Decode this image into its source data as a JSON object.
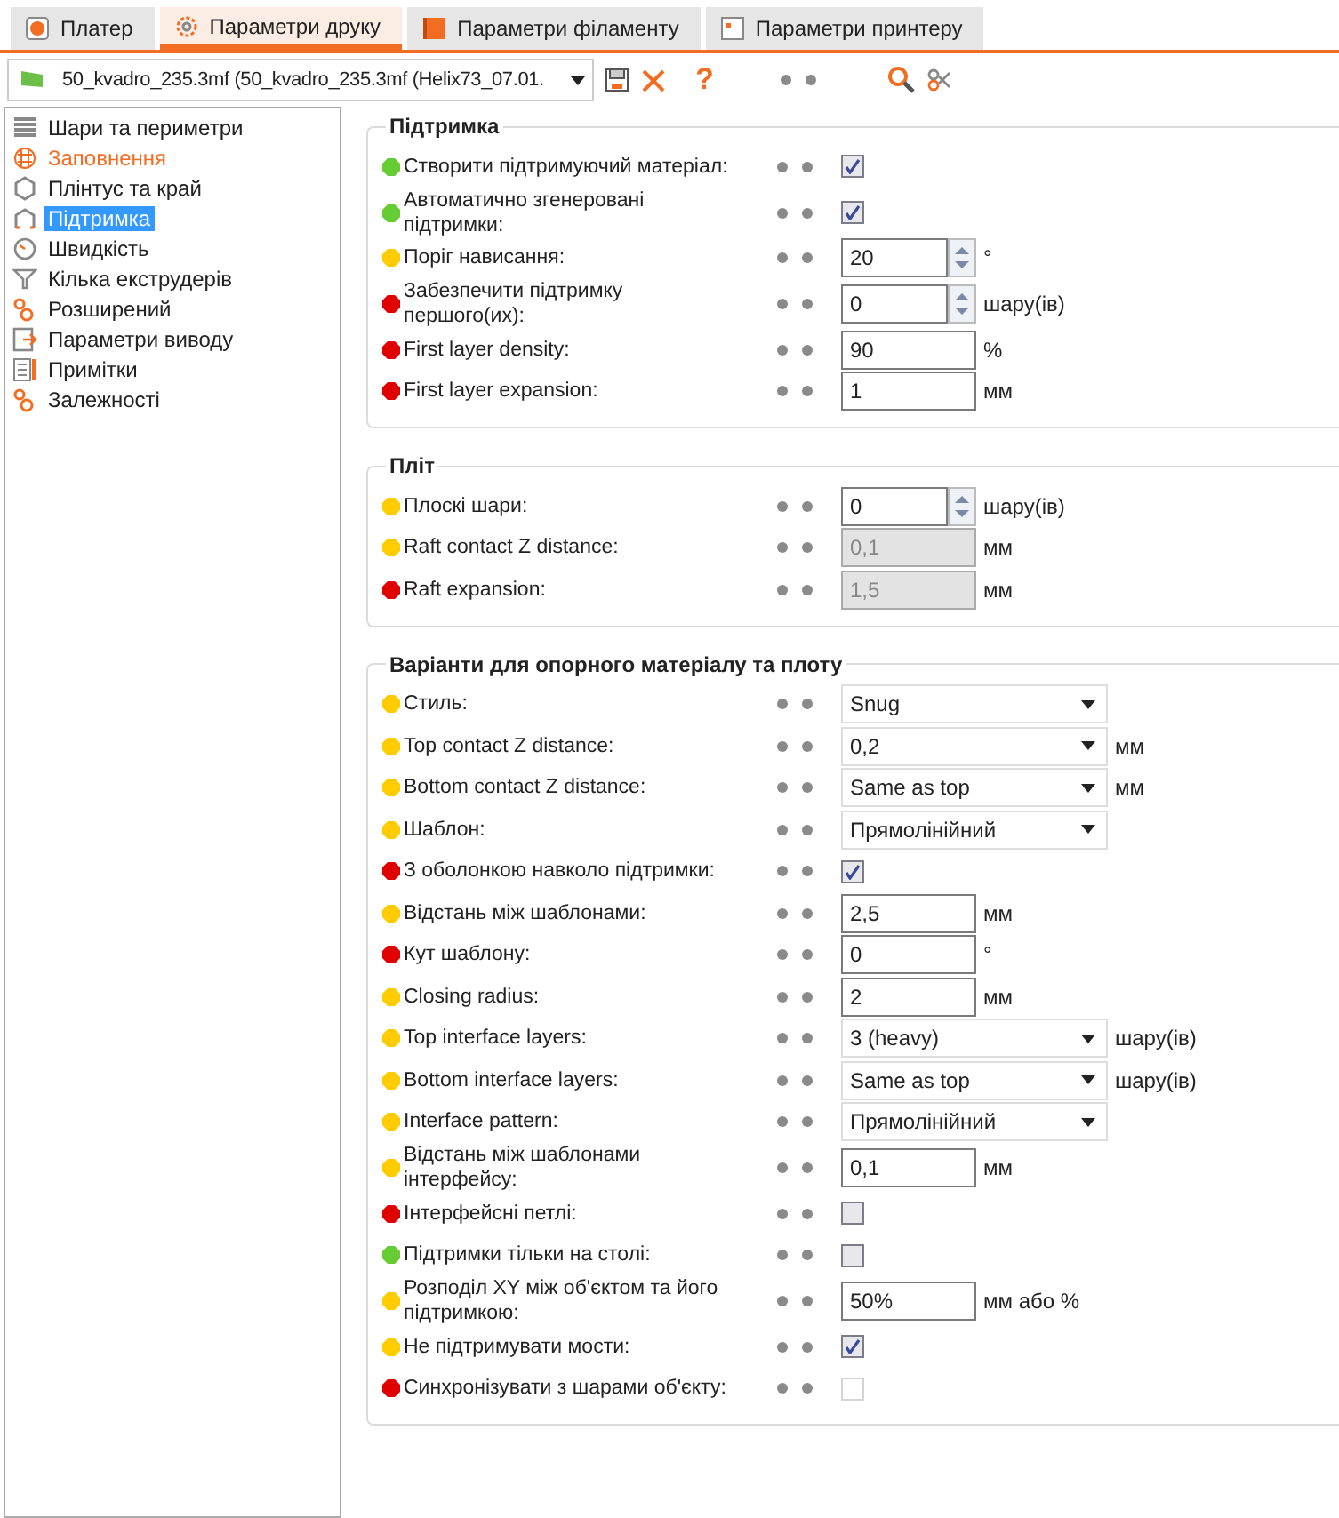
{
  "tabs": [
    {
      "label": "Платер",
      "selected": false
    },
    {
      "label": "Параметри друку",
      "selected": true
    },
    {
      "label": "Параметри філаменту",
      "selected": false
    },
    {
      "label": "Параметри принтеру",
      "selected": false
    }
  ],
  "toolbar": {
    "preset": "50_kvadro_235.3mf (50_kvadro_235.3mf (Helix73_07.01.",
    "help": "?"
  },
  "sidebar": {
    "items": [
      {
        "label": "Шари та периметри",
        "selected": false,
        "modified": false
      },
      {
        "label": "Заповнення",
        "selected": false,
        "modified": true
      },
      {
        "label": "Плінтус та край",
        "selected": false,
        "modified": false
      },
      {
        "label": "Підтримка",
        "selected": true,
        "modified": false
      },
      {
        "label": "Швидкість",
        "selected": false,
        "modified": false
      },
      {
        "label": "Кілька екструдерів",
        "selected": false,
        "modified": false
      },
      {
        "label": "Розширений",
        "selected": false,
        "modified": false
      },
      {
        "label": "Параметри виводу",
        "selected": false,
        "modified": false
      },
      {
        "label": "Примітки",
        "selected": false,
        "modified": false
      },
      {
        "label": "Залежності",
        "selected": false,
        "modified": false
      }
    ]
  },
  "groups": [
    {
      "title": "Підтримка",
      "rows": [
        {
          "kind": "checkbox",
          "label": "Створити підтримуючий матеріал:",
          "color": "#66cc33",
          "checked": true
        },
        {
          "kind": "checkbox",
          "label": "Автоматично згенеровані підтримки:",
          "color": "#66cc33",
          "checked": true
        },
        {
          "kind": "spin",
          "label": "Поріг нависання:",
          "color": "#ffcc00",
          "value": "20",
          "unit": "°"
        },
        {
          "kind": "spin",
          "label": "Забезпечити підтримку першого(их):",
          "color": "#e00000",
          "value": "0",
          "unit": "шару(ів)"
        },
        {
          "kind": "text",
          "label": "First layer density:",
          "color": "#e00000",
          "value": "90",
          "unit": "%"
        },
        {
          "kind": "text",
          "label": "First layer expansion:",
          "color": "#e00000",
          "value": "1",
          "unit": "мм"
        }
      ]
    },
    {
      "title": "Пліт",
      "rows": [
        {
          "kind": "spin",
          "label": "Плоскі шари:",
          "color": "#ffcc00",
          "value": "0",
          "unit": "шару(ів)"
        },
        {
          "kind": "text",
          "label": "Raft contact Z distance:",
          "color": "#ffcc00",
          "value": "0,1",
          "unit": "мм",
          "disabled": true
        },
        {
          "kind": "text",
          "label": "Raft expansion:",
          "color": "#e00000",
          "value": "1,5",
          "unit": "мм",
          "disabled": true
        }
      ]
    },
    {
      "title": "Варіанти для опорного матеріалу та плоту",
      "rows": [
        {
          "kind": "select",
          "label": "Стиль:",
          "color": "#ffcc00",
          "value": "Snug"
        },
        {
          "kind": "select",
          "label": "Top contact Z distance:",
          "color": "#ffcc00",
          "value": "0,2",
          "unit": "мм"
        },
        {
          "kind": "select",
          "label": "Bottom contact Z distance:",
          "color": "#ffcc00",
          "value": "Same as top",
          "unit": "мм"
        },
        {
          "kind": "select",
          "label": "Шаблон:",
          "color": "#ffcc00",
          "value": "Прямолінійний"
        },
        {
          "kind": "checkbox",
          "label": "З оболонкою навколо підтримки:",
          "color": "#e00000",
          "checked": true
        },
        {
          "kind": "text",
          "label": "Відстань між шаблонами:",
          "color": "#ffcc00",
          "value": "2,5",
          "unit": "мм"
        },
        {
          "kind": "text",
          "label": "Кут шаблону:",
          "color": "#e00000",
          "value": "0",
          "unit": "°"
        },
        {
          "kind": "text",
          "label": "Closing radius:",
          "color": "#ffcc00",
          "value": "2",
          "unit": "мм"
        },
        {
          "kind": "select",
          "label": "Top interface layers:",
          "color": "#ffcc00",
          "value": "3 (heavy)",
          "unit": "шару(ів)"
        },
        {
          "kind": "select",
          "label": "Bottom interface layers:",
          "color": "#ffcc00",
          "value": "Same as top",
          "unit": "шару(ів)"
        },
        {
          "kind": "select",
          "label": "Interface pattern:",
          "color": "#ffcc00",
          "value": "Прямолінійний"
        },
        {
          "kind": "text",
          "label": "Відстань між шаблонами інтерфейсу:",
          "color": "#ffcc00",
          "value": "0,1",
          "unit": "мм"
        },
        {
          "kind": "checkbox",
          "label": "Інтерфейсні петлі:",
          "color": "#e00000",
          "checked": false
        },
        {
          "kind": "checkbox",
          "label": "Підтримки тільки на столі:",
          "color": "#66cc33",
          "checked": false
        },
        {
          "kind": "text",
          "label": "Розподіл XY між об'єктом та його підтримкою:",
          "color": "#ffcc00",
          "value": "50%",
          "unit": "мм або %"
        },
        {
          "kind": "checkbox",
          "label": "Не підтримувати мости:",
          "color": "#ffcc00",
          "checked": true
        },
        {
          "kind": "checkbox",
          "label": "Синхронізувати з шарами об'єкту:",
          "color": "#e00000",
          "checked": false,
          "disabled": true
        }
      ]
    }
  ]
}
